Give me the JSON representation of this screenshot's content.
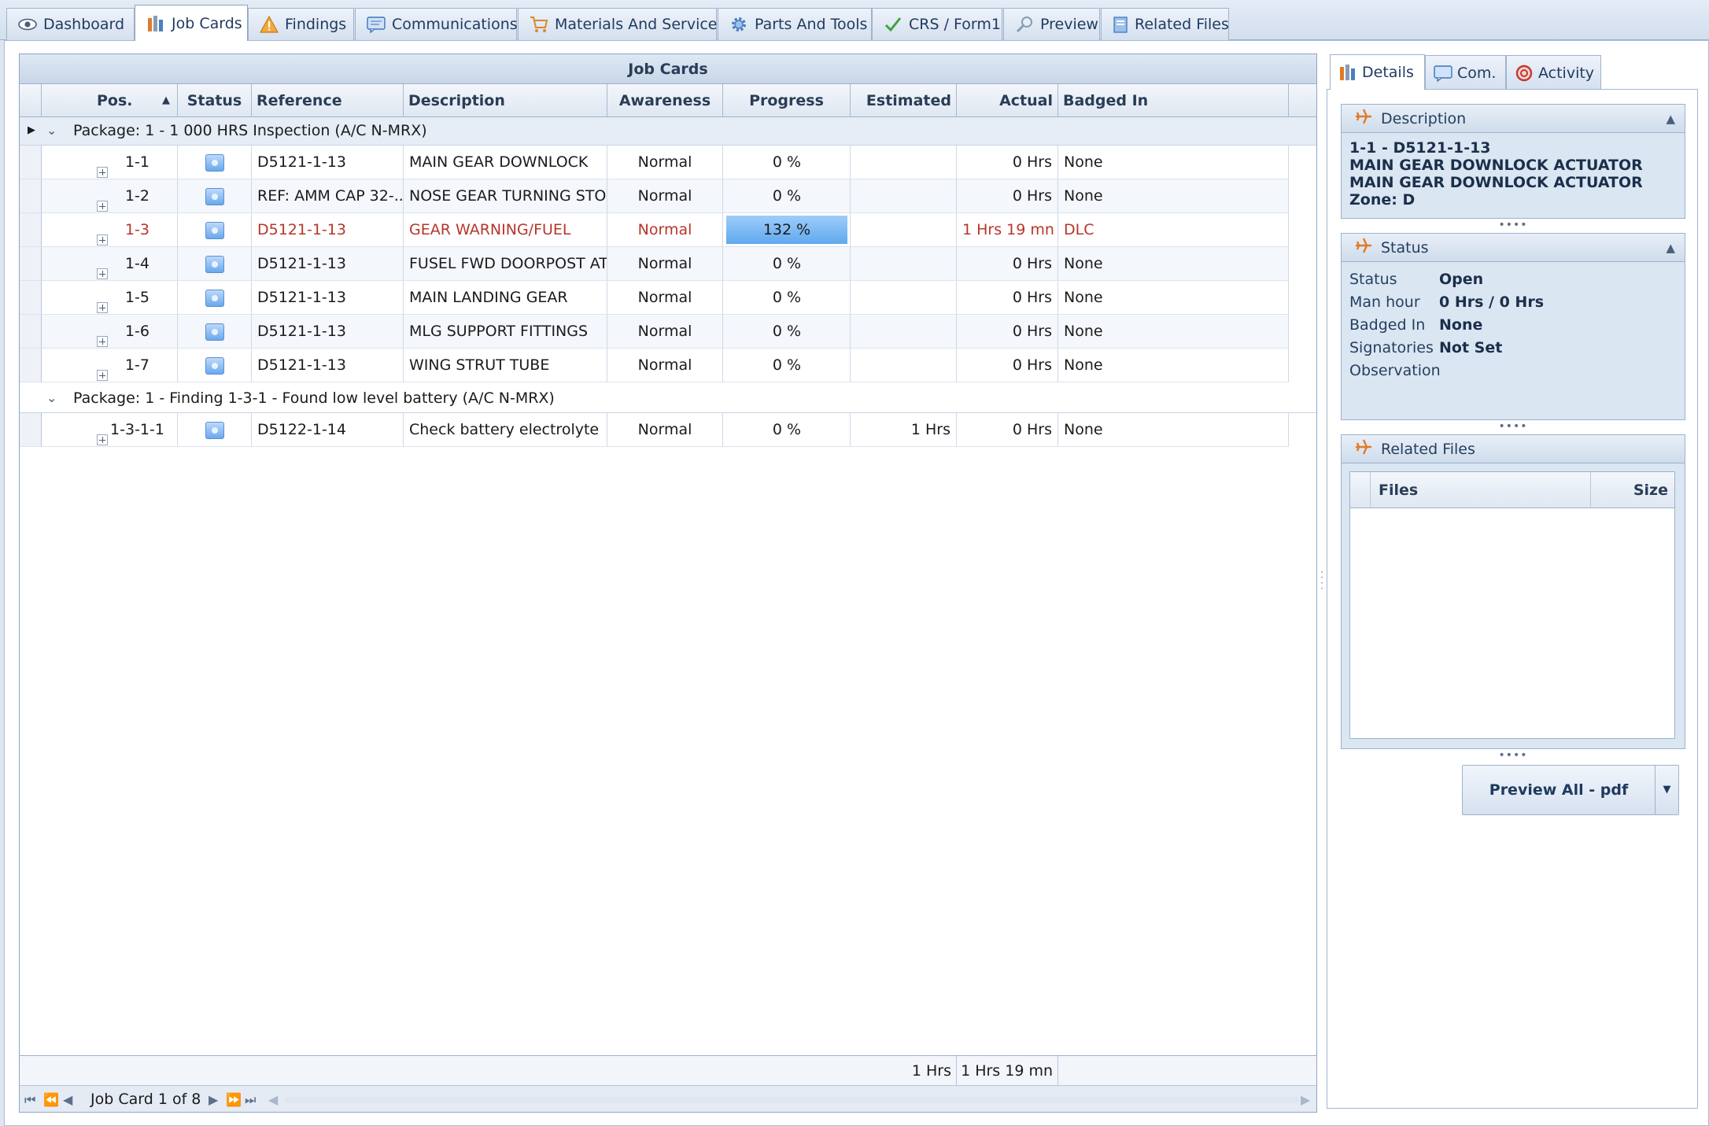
{
  "tabs": [
    {
      "label": "Dashboard",
      "icon": "eye-icon"
    },
    {
      "label": "Job Cards",
      "icon": "job-cards-icon"
    },
    {
      "label": "Findings",
      "icon": "warning-icon"
    },
    {
      "label": "Communications",
      "icon": "message-icon"
    },
    {
      "label": "Materials And Services",
      "icon": "cart-icon"
    },
    {
      "label": "Parts And Tools",
      "icon": "gear-icon"
    },
    {
      "label": "CRS / Form1",
      "icon": "check-icon"
    },
    {
      "label": "Preview",
      "icon": "magnifier-icon"
    },
    {
      "label": "Related Files",
      "icon": "files-icon"
    }
  ],
  "grid": {
    "title": "Job Cards",
    "columns": [
      "Pos.",
      "Status",
      "Reference",
      "Description",
      "Awareness",
      "Progress",
      "Estimated",
      "Actual",
      "Badged In"
    ],
    "sort_icon": "sort-ascending-icon",
    "groups": [
      {
        "label": "Package: 1 - 1 000 HRS Inspection (A/C N-MRX)",
        "rows": [
          {
            "pos": "1-1",
            "reference": "D5121-1-13",
            "description": "MAIN GEAR DOWNLOCK",
            "awareness": "Normal",
            "progress": "0 %",
            "estimated": "",
            "actual": "0 Hrs",
            "badged": "None"
          },
          {
            "pos": "1-2",
            "reference": "REF: AMM CAP 32-...",
            "description": "NOSE GEAR TURNING STOP",
            "awareness": "Normal",
            "progress": "0 %",
            "estimated": "",
            "actual": "0 Hrs",
            "badged": "None"
          },
          {
            "pos": "1-3",
            "reference": "D5121-1-13",
            "description": "GEAR WARNING/FUEL",
            "awareness": "Normal",
            "progress": "132 %",
            "progress_fraction": 1.32,
            "estimated": "",
            "actual": "1 Hrs 19 mn",
            "badged": "DLC",
            "highlight": true
          },
          {
            "pos": "1-4",
            "reference": "D5121-1-13",
            "description": "FUSEL FWD DOORPOST AT",
            "awareness": "Normal",
            "progress": "0 %",
            "estimated": "",
            "actual": "0 Hrs",
            "badged": "None"
          },
          {
            "pos": "1-5",
            "reference": "D5121-1-13",
            "description": "MAIN LANDING GEAR",
            "awareness": "Normal",
            "progress": "0 %",
            "estimated": "",
            "actual": "0 Hrs",
            "badged": "None"
          },
          {
            "pos": "1-6",
            "reference": "D5121-1-13",
            "description": "MLG SUPPORT FITTINGS",
            "awareness": "Normal",
            "progress": "0 %",
            "estimated": "",
            "actual": "0 Hrs",
            "badged": "None"
          },
          {
            "pos": "1-7",
            "reference": "D5121-1-13",
            "description": "WING STRUT TUBE",
            "awareness": "Normal",
            "progress": "0 %",
            "estimated": "",
            "actual": "0 Hrs",
            "badged": "None"
          }
        ]
      },
      {
        "label": "Package: 1 - Finding 1-3-1 - Found low level battery (A/C N-MRX)",
        "rows": [
          {
            "pos": "1-3-1-1",
            "reference": "D5122-1-14",
            "description": "Check battery electrolyte",
            "awareness": "Normal",
            "progress": "0 %",
            "estimated": "1 Hrs",
            "actual": "0 Hrs",
            "badged": "None"
          }
        ]
      }
    ],
    "totals": {
      "estimated": "1 Hrs",
      "actual": "1 Hrs 19 mn"
    },
    "navigator": {
      "label": "Job Card 1 of 8"
    }
  },
  "right": {
    "tabs": [
      {
        "label": "Details",
        "icon": "details-icon"
      },
      {
        "label": "Com.",
        "icon": "message-icon"
      },
      {
        "label": "Activity",
        "icon": "activity-icon"
      }
    ],
    "description": {
      "title": "Description",
      "lines": [
        "1-1 - D5121-1-13",
        "MAIN GEAR DOWNLOCK ACTUATOR",
        "MAIN GEAR DOWNLOCK ACTUATOR",
        "Zone: D"
      ]
    },
    "status": {
      "title": "Status",
      "items": [
        {
          "k": "Status",
          "v": "Open"
        },
        {
          "k": "Man hour",
          "v": "0 Hrs / 0 Hrs"
        },
        {
          "k": "Badged In",
          "v": "None"
        },
        {
          "k": "Signatories",
          "v": "Not Set"
        },
        {
          "k": "Observation",
          "v": ""
        }
      ]
    },
    "related_files": {
      "title": "Related Files",
      "columns": [
        "Files",
        "Size"
      ]
    },
    "preview_button": "Preview All - pdf"
  },
  "colors": {
    "accent": "#5fa9ef",
    "highlight_text": "#b8352a",
    "header_bg": "#c8d6e8"
  }
}
